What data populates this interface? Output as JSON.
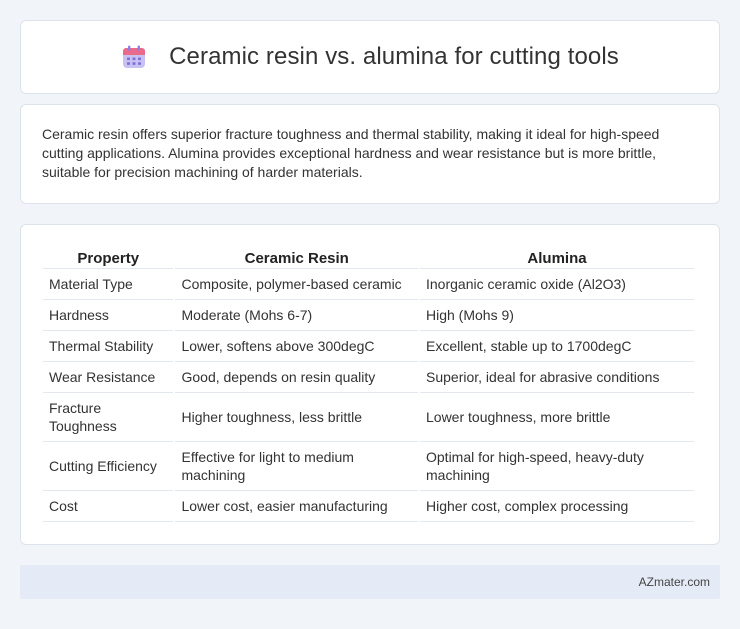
{
  "header": {
    "title": "Ceramic resin vs. alumina for cutting tools",
    "icon": "calendar-icon"
  },
  "summary": {
    "text": "Ceramic resin offers superior fracture toughness and thermal stability, making it ideal for high-speed cutting applications. Alumina provides exceptional hardness and wear resistance but is more brittle, suitable for precision machining of harder materials."
  },
  "table": {
    "headers": [
      "Property",
      "Ceramic Resin",
      "Alumina"
    ],
    "rows": [
      [
        "Material Type",
        "Composite, polymer-based ceramic",
        "Inorganic ceramic oxide (Al2O3)"
      ],
      [
        "Hardness",
        "Moderate (Mohs 6-7)",
        "High (Mohs 9)"
      ],
      [
        "Thermal Stability",
        "Lower, softens above 300degC",
        "Excellent, stable up to 1700degC"
      ],
      [
        "Wear Resistance",
        "Good, depends on resin quality",
        "Superior, ideal for abrasive conditions"
      ],
      [
        "Fracture Toughness",
        "Higher toughness, less brittle",
        "Lower toughness, more brittle"
      ],
      [
        "Cutting Efficiency",
        "Effective for light to medium machining",
        "Optimal for high-speed, heavy-duty machining"
      ],
      [
        "Cost",
        "Lower cost, easier manufacturing",
        "Higher cost, complex processing"
      ]
    ]
  },
  "footer": {
    "text": "AZmater.com"
  },
  "colors": {
    "background": "#f1f4f9",
    "footer_bar": "#e5ebf6",
    "icon_purple": "#8d7fe0",
    "icon_header": "#e96a8b"
  }
}
